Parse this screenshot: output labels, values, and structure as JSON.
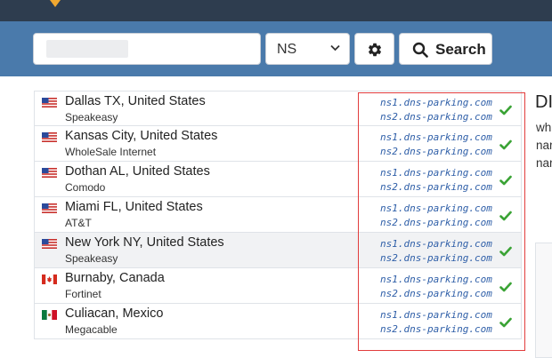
{
  "search": {
    "query": "",
    "record_type": "NS",
    "button_label": "Search"
  },
  "results": [
    {
      "flag": "us",
      "location": "Dallas TX, United States",
      "isp": "Speakeasy",
      "ns1": "ns1.dns-parking.com",
      "ns2": "ns2.dns-parking.com",
      "status": "ok",
      "highlighted": false
    },
    {
      "flag": "us",
      "location": "Kansas City, United States",
      "isp": "WholeSale Internet",
      "ns1": "ns1.dns-parking.com",
      "ns2": "ns2.dns-parking.com",
      "status": "ok",
      "highlighted": false
    },
    {
      "flag": "us",
      "location": "Dothan AL, United States",
      "isp": "Comodo",
      "ns1": "ns1.dns-parking.com",
      "ns2": "ns2.dns-parking.com",
      "status": "ok",
      "highlighted": false
    },
    {
      "flag": "us",
      "location": "Miami FL, United States",
      "isp": "AT&T",
      "ns1": "ns1.dns-parking.com",
      "ns2": "ns2.dns-parking.com",
      "status": "ok",
      "highlighted": false
    },
    {
      "flag": "us",
      "location": "New York NY, United States",
      "isp": "Speakeasy",
      "ns1": "ns1.dns-parking.com",
      "ns2": "ns2.dns-parking.com",
      "status": "ok",
      "highlighted": true
    },
    {
      "flag": "ca",
      "location": "Burnaby, Canada",
      "isp": "Fortinet",
      "ns1": "ns1.dns-parking.com",
      "ns2": "ns2.dns-parking.com",
      "status": "ok",
      "highlighted": false
    },
    {
      "flag": "mx",
      "location": "Culiacan, Mexico",
      "isp": "Megacable",
      "ns1": "ns1.dns-parking.com",
      "ns2": "ns2.dns-parking.com",
      "status": "ok",
      "highlighted": false
    }
  ],
  "side": {
    "title": "DI",
    "lines": [
      "wh",
      "nar",
      "nar"
    ]
  },
  "colors": {
    "topbar": "#2e3d4f",
    "searchbar": "#4a7aab",
    "accent": "#f0a830",
    "link": "#2f5fa8",
    "check": "#3aa335",
    "highlight_frame": "#e23c3c"
  },
  "icons": {
    "settings": "gear-icon",
    "search": "magnifier-icon",
    "status_ok": "check-icon",
    "dropdown": "chevron-down-icon"
  }
}
